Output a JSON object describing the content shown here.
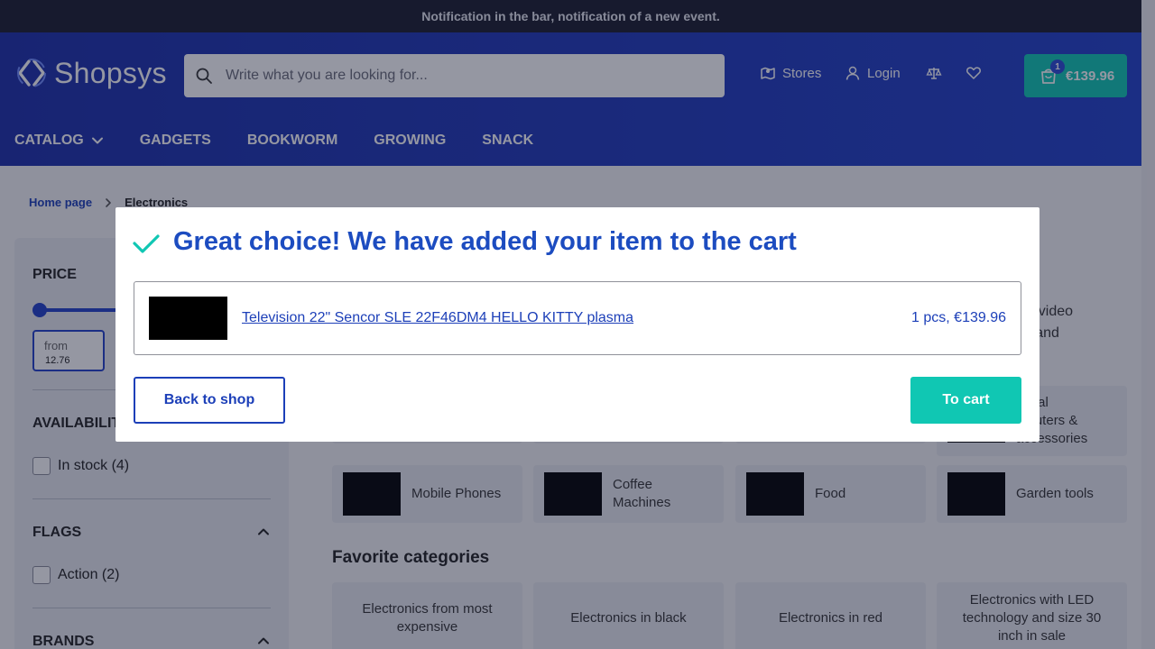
{
  "topbar": {
    "notification": "Notification in the bar, notification of a new event."
  },
  "header": {
    "logo_text": "Shopsys",
    "search_placeholder": "Write what you are looking for...",
    "stores_label": "Stores",
    "login_label": "Login",
    "cart": {
      "count": "1",
      "total": "€139.96"
    },
    "nav": [
      "CATALOG",
      "GADGETS",
      "BOOKWORM",
      "GROWING",
      "SNACK"
    ]
  },
  "breadcrumb": {
    "home": "Home page",
    "current": "Electronics"
  },
  "filters": {
    "price_title": "PRICE",
    "from_label": "from",
    "from_value": "12.76",
    "availability_title": "AVAILABILITY",
    "in_stock": "In stock (4)",
    "flags_title": "FLAGS",
    "action": "Action (2)",
    "brands_title": "BRANDS"
  },
  "category_description": {
    "line1": "ds, video",
    "line2": "c.) and"
  },
  "categories": {
    "row1": [
      {
        "label": ""
      },
      {
        "label": ""
      },
      {
        "label": ""
      },
      {
        "label": "sonal\nmputers &\naccessories"
      }
    ],
    "row2": [
      {
        "label": "Mobile Phones"
      },
      {
        "label": "Coffee Machines"
      },
      {
        "label": "Food"
      },
      {
        "label": "Garden tools"
      }
    ]
  },
  "favorite": {
    "title": "Favorite categories",
    "items": [
      "Electronics from most expensive",
      "Electronics in black",
      "Electronics in red",
      "Electronics with LED technology and size 30 inch in sale"
    ]
  },
  "modal": {
    "title": "Great choice! We have added your item to the cart",
    "product_name": "Television 22\" Sencor SLE 22F46DM4 HELLO KITTY plasma",
    "product_qty_price": "1 pcs, €139.96",
    "back_button": "Back to shop",
    "cart_button": "To cart"
  },
  "colors": {
    "header_blue": "#2240c8",
    "accent_teal": "#10c7b3",
    "link_blue": "#1c3fb8",
    "topbar": "#1b1d2c"
  }
}
